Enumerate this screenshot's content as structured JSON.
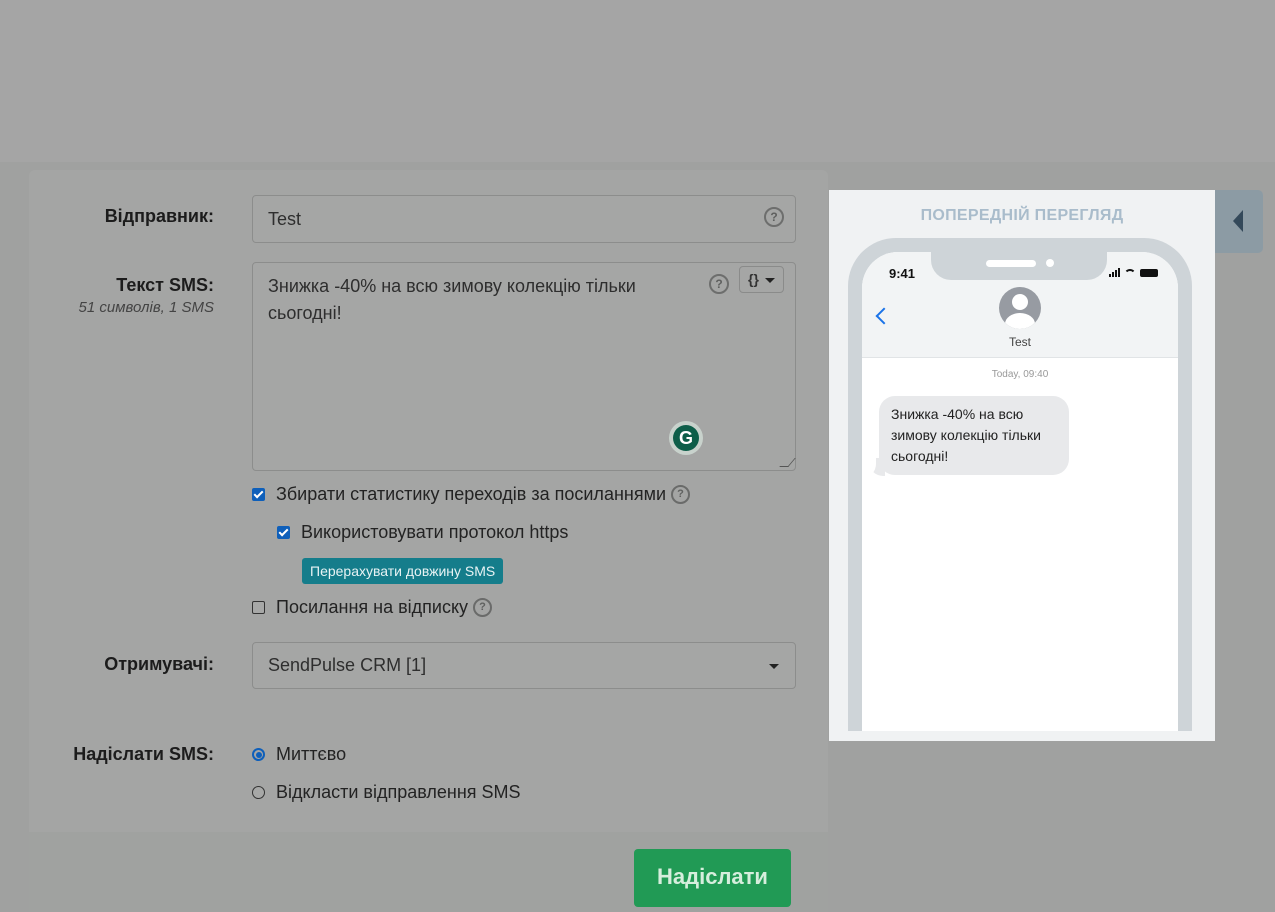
{
  "form": {
    "sender_label": "Відправник:",
    "sender_value": "Test",
    "sms_text_label": "Текст SMS:",
    "sms_counter": "51 символів, 1 SMS",
    "sms_text_value": "Знижка -40% на всю зимову колекцію тільки сьогодні!",
    "variables_button_label": "{}",
    "help_glyph": "?",
    "track_clicks_label": "Збирати статистику переходів за посиланнями",
    "track_clicks_checked": true,
    "use_https_label": "Використовувати протокол https",
    "use_https_checked": true,
    "recalculate_button_label": "Перерахувати довжину SMS",
    "unsubscribe_link_label": "Посилання на відписку",
    "unsubscribe_link_checked": false,
    "recipients_label": "Отримувачі:",
    "recipients_value": "SendPulse CRM [1]",
    "send_sms_label": "Надіслати SMS:",
    "send_options": [
      {
        "label": "Миттєво",
        "selected": true
      },
      {
        "label": "Відкласти відправлення SMS",
        "selected": false
      }
    ],
    "submit_button_label": "Надіслати"
  },
  "preview": {
    "title": "ПОПЕРЕДНІЙ ПЕРЕГЛЯД",
    "clock": "9:41",
    "contact_name": "Test",
    "timestamp": "Today, 09:40",
    "message": "Знижка -40% на всю зимову колекцію тільки сьогодні!"
  },
  "icons": {
    "grammarly": "G",
    "collapse_panel": "chevron-left-icon"
  },
  "colors": {
    "primary_blue": "#0e5fba",
    "teal_button": "#157d8b",
    "submit_green": "#219a55",
    "ios_blue": "#1a73e8"
  }
}
